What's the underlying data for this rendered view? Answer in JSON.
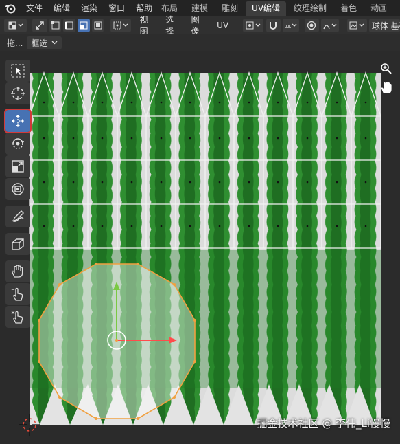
{
  "menubar": {
    "items": [
      "文件",
      "编辑",
      "渲染",
      "窗口",
      "帮助"
    ],
    "workspaces": [
      "布局",
      "建模",
      "雕刻",
      "UV编辑",
      "纹理绘制",
      "着色",
      "动画"
    ],
    "active_workspace": "UV编辑"
  },
  "header": {
    "menus": [
      "视图",
      "选择",
      "图像",
      "UV"
    ],
    "shading_label": "球体 基础"
  },
  "subheader": {
    "drag_label": "拖...",
    "select_mode": "框选"
  },
  "toolbar": {
    "tools": [
      "select-box",
      "cursor",
      "move",
      "rotate",
      "scale",
      "transform",
      "annotate",
      "rip",
      "grab",
      "relax",
      "pinch"
    ],
    "active_tool": "move"
  },
  "colors": {
    "accent": "#4772b3",
    "texture_green": "#2e8b2e",
    "uv_edge": "#f0a040",
    "gizmo_x": "#ff4c4c",
    "gizmo_y": "#7ac943"
  },
  "watermark": "掘金技术社区 @ 李伟_Li慢慢"
}
